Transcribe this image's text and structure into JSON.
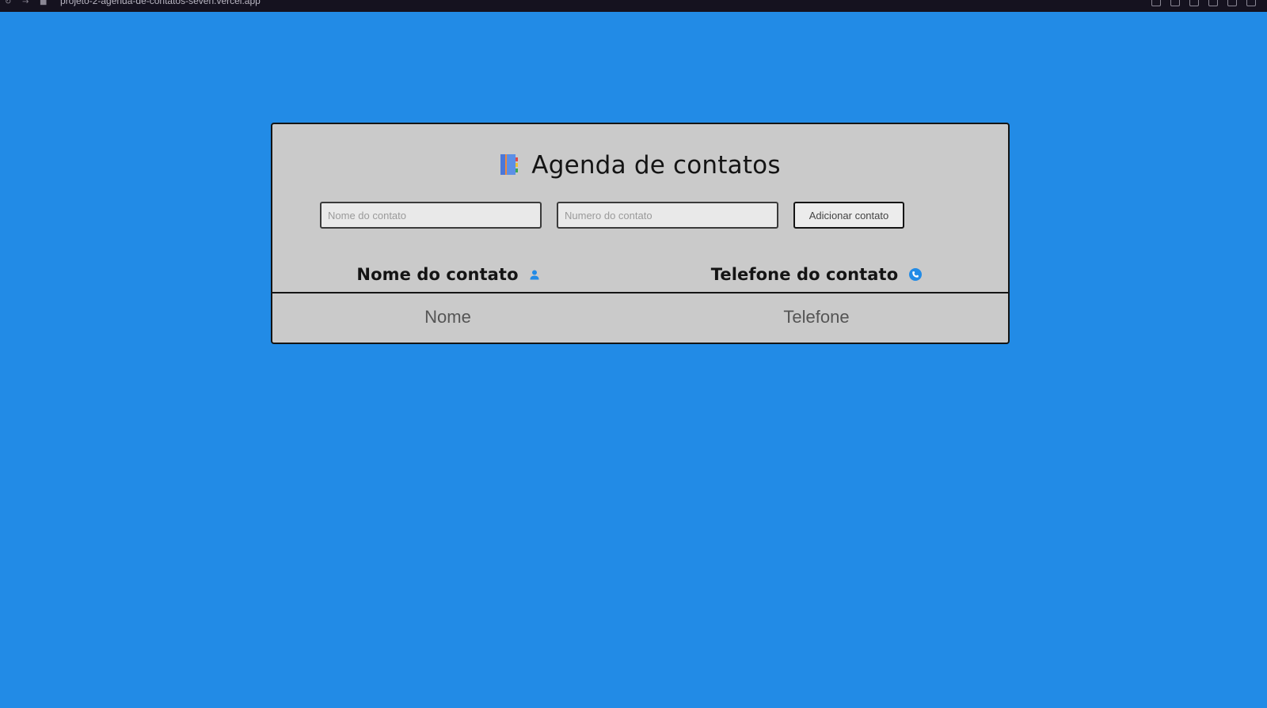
{
  "browser": {
    "url": "projeto-2-agenda-de-contatos-seven.vercel.app"
  },
  "app": {
    "title": "Agenda de contatos",
    "title_icon": "address-book-icon",
    "accent_color": "#228be6"
  },
  "form": {
    "name_placeholder": "Nome do contato",
    "name_value": "",
    "number_placeholder": "Numero do contato",
    "number_value": "",
    "add_label": "Adicionar contato"
  },
  "table": {
    "headers": [
      {
        "label": "Nome do contato",
        "icon": "user-icon"
      },
      {
        "label": "Telefone do contato",
        "icon": "phone-icon"
      }
    ],
    "rows": [
      {
        "name": "Nome",
        "phone": "Telefone"
      }
    ]
  }
}
